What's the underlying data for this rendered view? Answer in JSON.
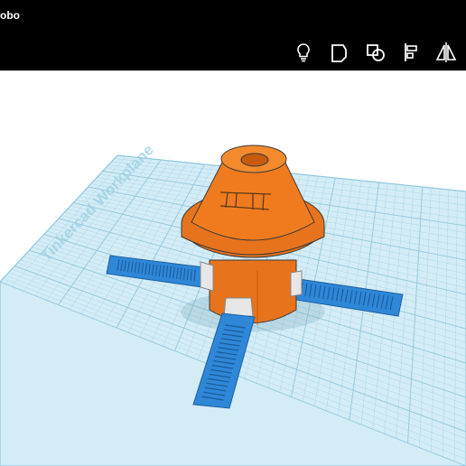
{
  "window": {
    "title": "obo"
  },
  "toolbar": {
    "buttons": [
      {
        "id": "notes",
        "icon": "lightbulb-icon"
      },
      {
        "id": "group",
        "icon": "group-shape-icon"
      },
      {
        "id": "ungroup",
        "icon": "ungroup-shape-icon"
      },
      {
        "id": "align",
        "icon": "align-icon"
      },
      {
        "id": "mirror",
        "icon": "mirror-icon"
      }
    ]
  },
  "workplane": {
    "watermark": "Tinkercad Workplane",
    "grid_color": "#8fc9dd",
    "plane_color": "#d4ecf6"
  },
  "model": {
    "body_color": "#f07b1e",
    "rail_color": "#2f87d8"
  }
}
